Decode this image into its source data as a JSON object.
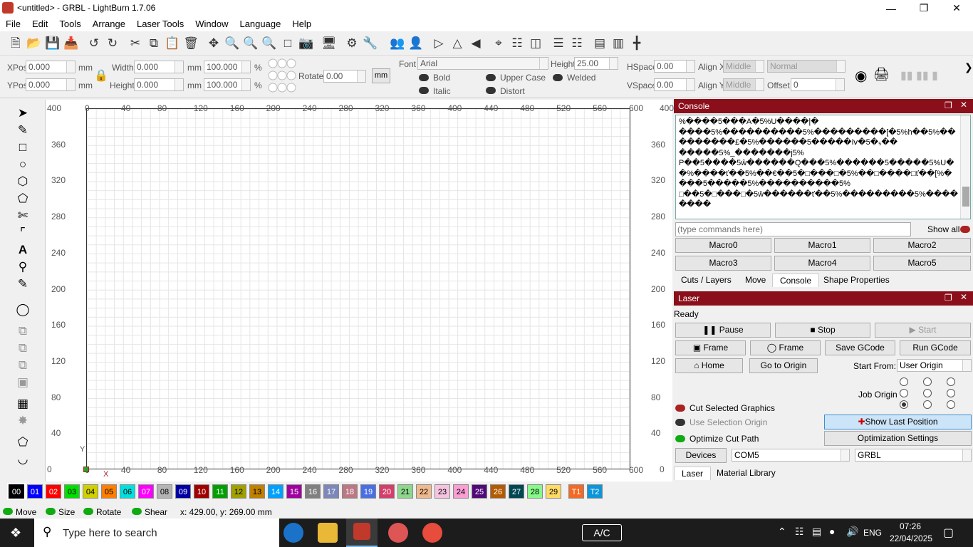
{
  "window": {
    "title": "<untitled> - GRBL - LightBurn 1.7.06"
  },
  "menu": [
    "File",
    "Edit",
    "Tools",
    "Arrange",
    "Laser Tools",
    "Window",
    "Language",
    "Help"
  ],
  "props": {
    "xpos_label": "XPos",
    "xpos": "0.000",
    "ypos_label": "YPos",
    "ypos": "0.000",
    "mm": "mm",
    "width_label": "Width",
    "width": "0.000",
    "height_label": "Height",
    "height": "0.000",
    "pct_w": "100.000",
    "pct_h": "100.000",
    "pct": "%",
    "rotate_label": "Rotate",
    "rotate": "0.00",
    "unit_btn": "mm",
    "font_label": "Font",
    "font": "Arial",
    "fheight_label": "Height",
    "fheight": "25.00",
    "hspace_label": "HSpace",
    "hspace": "0.00",
    "vspace_label": "VSpace",
    "vspace": "0.00",
    "alignx_label": "Align X",
    "alignx": "Middle",
    "aligny_label": "Align Y",
    "aligny": "Middle",
    "normal": "Normal",
    "offset_label": "Offset",
    "offset": "0",
    "bold": "Bold",
    "italic": "Italic",
    "upper": "Upper Case",
    "distort": "Distort",
    "welded": "Welded"
  },
  "ruler": {
    "x": [
      "0",
      "40",
      "80",
      "120",
      "160",
      "200",
      "240",
      "280",
      "320",
      "360",
      "400",
      "440",
      "480",
      "520",
      "560",
      "600"
    ],
    "y": [
      "400",
      "360",
      "320",
      "280",
      "240",
      "200",
      "160",
      "120",
      "80",
      "40",
      "0"
    ],
    "corner_tl": "400",
    "corner_bl": "0",
    "corner_tr": "400",
    "corner_br": "0",
    "axis_y": "Y",
    "axis_x": "X"
  },
  "console": {
    "title": "Console",
    "output": "%����5���A�5%U����|�\n����5%����������5%���������[�5%h��5%���������£�5%������5�����ⅳ�5�₅��\n�����5%_�������j5%\nP��5����5ŵ������Q���5%������5�����5%U��%����ť��5%��€��5�□���□�5%��□����□ť��[%����5�����5%����������5%\n□��5�□���□�5ŵ������ť��5%���������5%��������",
    "input_placeholder": "(type commands here)",
    "show_all": "Show all",
    "macros": [
      "Macro0",
      "Macro1",
      "Macro2",
      "Macro3",
      "Macro4",
      "Macro5"
    ],
    "tabs": [
      "Cuts / Layers",
      "Move",
      "Console",
      "Shape Properties"
    ]
  },
  "laser": {
    "title": "Laser",
    "status": "Ready",
    "pause": "Pause",
    "stop": "Stop",
    "start": "Start",
    "frame1": "Frame",
    "frame2": "Frame",
    "save_gcode": "Save GCode",
    "run_gcode": "Run GCode",
    "home": "Home",
    "go_origin": "Go to Origin",
    "start_from_label": "Start From:",
    "start_from": "User Origin",
    "job_origin_label": "Job Origin",
    "cut_selected": "Cut Selected Graphics",
    "use_sel_origin": "Use Selection Origin",
    "optimize": "Optimize Cut Path",
    "show_last": "Show Last Position",
    "opt_settings": "Optimization Settings",
    "devices": "Devices",
    "port": "COM5",
    "device": "GRBL",
    "tabs": [
      "Laser",
      "Material Library"
    ]
  },
  "palette": [
    {
      "n": "00",
      "c": "#000000",
      "t": "#ffffff"
    },
    {
      "n": "01",
      "c": "#0000ff",
      "t": "#ffffff"
    },
    {
      "n": "02",
      "c": "#ff0000",
      "t": "#ffffff"
    },
    {
      "n": "03",
      "c": "#00e000",
      "t": "#000000"
    },
    {
      "n": "04",
      "c": "#d0d000",
      "t": "#000000"
    },
    {
      "n": "05",
      "c": "#ff8000",
      "t": "#000000"
    },
    {
      "n": "06",
      "c": "#00e0e0",
      "t": "#000000"
    },
    {
      "n": "07",
      "c": "#ff00ff",
      "t": "#ffffff"
    },
    {
      "n": "08",
      "c": "#b4b4b4",
      "t": "#000000"
    },
    {
      "n": "09",
      "c": "#0000a0",
      "t": "#ffffff"
    },
    {
      "n": "10",
      "c": "#a00000",
      "t": "#ffffff"
    },
    {
      "n": "11",
      "c": "#00a000",
      "t": "#ffffff"
    },
    {
      "n": "12",
      "c": "#a0a000",
      "t": "#000000"
    },
    {
      "n": "13",
      "c": "#c08000",
      "t": "#000000"
    },
    {
      "n": "14",
      "c": "#00a0ff",
      "t": "#ffffff"
    },
    {
      "n": "15",
      "c": "#a000a0",
      "t": "#ffffff"
    },
    {
      "n": "16",
      "c": "#808080",
      "t": "#ffffff"
    },
    {
      "n": "17",
      "c": "#7d87b9",
      "t": "#ffffff"
    },
    {
      "n": "18",
      "c": "#bb7784",
      "t": "#ffffff"
    },
    {
      "n": "19",
      "c": "#4a6fe3",
      "t": "#ffffff"
    },
    {
      "n": "20",
      "c": "#d33f6a",
      "t": "#ffffff"
    },
    {
      "n": "21",
      "c": "#8cd78c",
      "t": "#000000"
    },
    {
      "n": "22",
      "c": "#f0b98d",
      "t": "#000000"
    },
    {
      "n": "23",
      "c": "#f6c4e1",
      "t": "#000000"
    },
    {
      "n": "24",
      "c": "#fa9ed4",
      "t": "#000000"
    },
    {
      "n": "25",
      "c": "#500a78",
      "t": "#ffffff"
    },
    {
      "n": "26",
      "c": "#b45a00",
      "t": "#ffffff"
    },
    {
      "n": "27",
      "c": "#004754",
      "t": "#ffffff"
    },
    {
      "n": "28",
      "c": "#86fa88",
      "t": "#000000"
    },
    {
      "n": "29",
      "c": "#ffdb66",
      "t": "#000000"
    },
    {
      "n": "T1",
      "c": "#f36926",
      "t": "#ffffff"
    },
    {
      "n": "T2",
      "c": "#0c96d9",
      "t": "#ffffff"
    }
  ],
  "status": {
    "move": "Move",
    "size": "Size",
    "rotate": "Rotate",
    "shear": "Shear",
    "coords": "x: 429.00, y: 269.00 mm"
  },
  "taskbar": {
    "search": "Type here to search",
    "ac": "A/C",
    "lang": "ENG",
    "time": "07:26",
    "date": "22/04/2025"
  }
}
